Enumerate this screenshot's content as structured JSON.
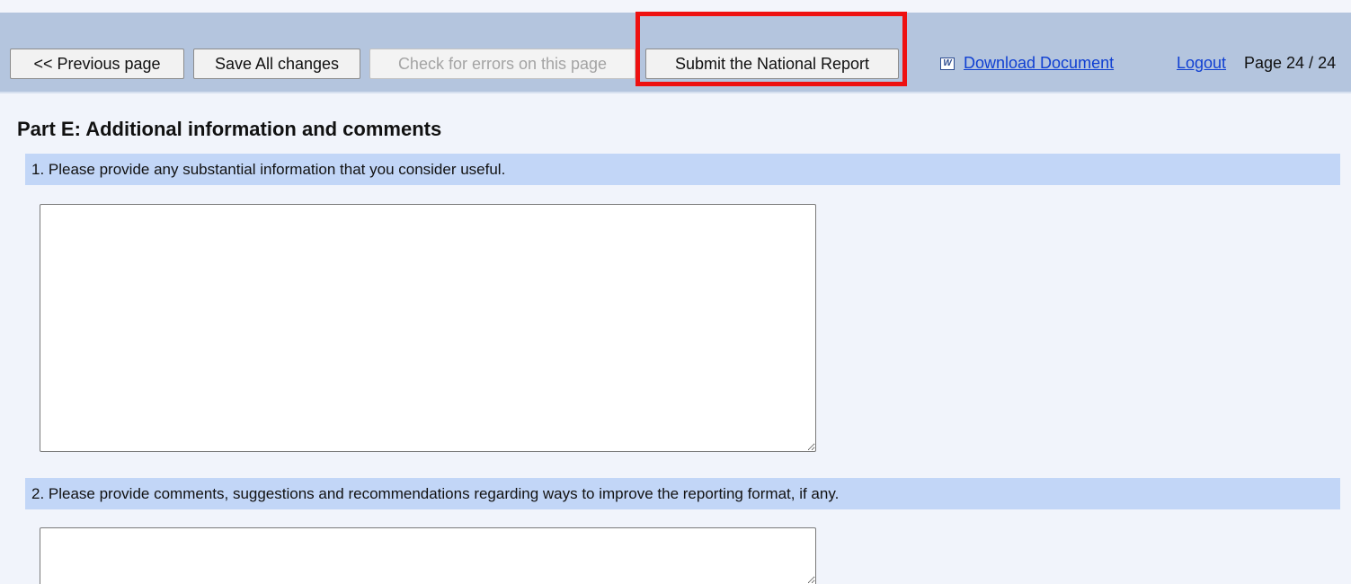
{
  "toolbar": {
    "previous_label": "<< Previous page",
    "save_label": "Save All changes",
    "check_label": "Check for errors on this page",
    "submit_label": "Submit the National Report",
    "word_icon_glyph": "W",
    "download_label": "Download Document",
    "logout_label": "Logout",
    "page_indicator": "Page 24 / 24"
  },
  "icons": {
    "download": "word-document-icon"
  },
  "colors": {
    "toolbar_bg": "#b4c5de",
    "highlight_border": "#ee1111",
    "question_bar": "#c2d6f7",
    "link": "#0f3fd2"
  },
  "main": {
    "title": "Part E: Additional information and comments",
    "questions": [
      {
        "label": "1. Please provide any substantial information that you consider useful.",
        "value": ""
      },
      {
        "label": "2. Please provide comments, suggestions and recommendations regarding ways to improve the reporting format, if any.",
        "value": ""
      }
    ]
  }
}
